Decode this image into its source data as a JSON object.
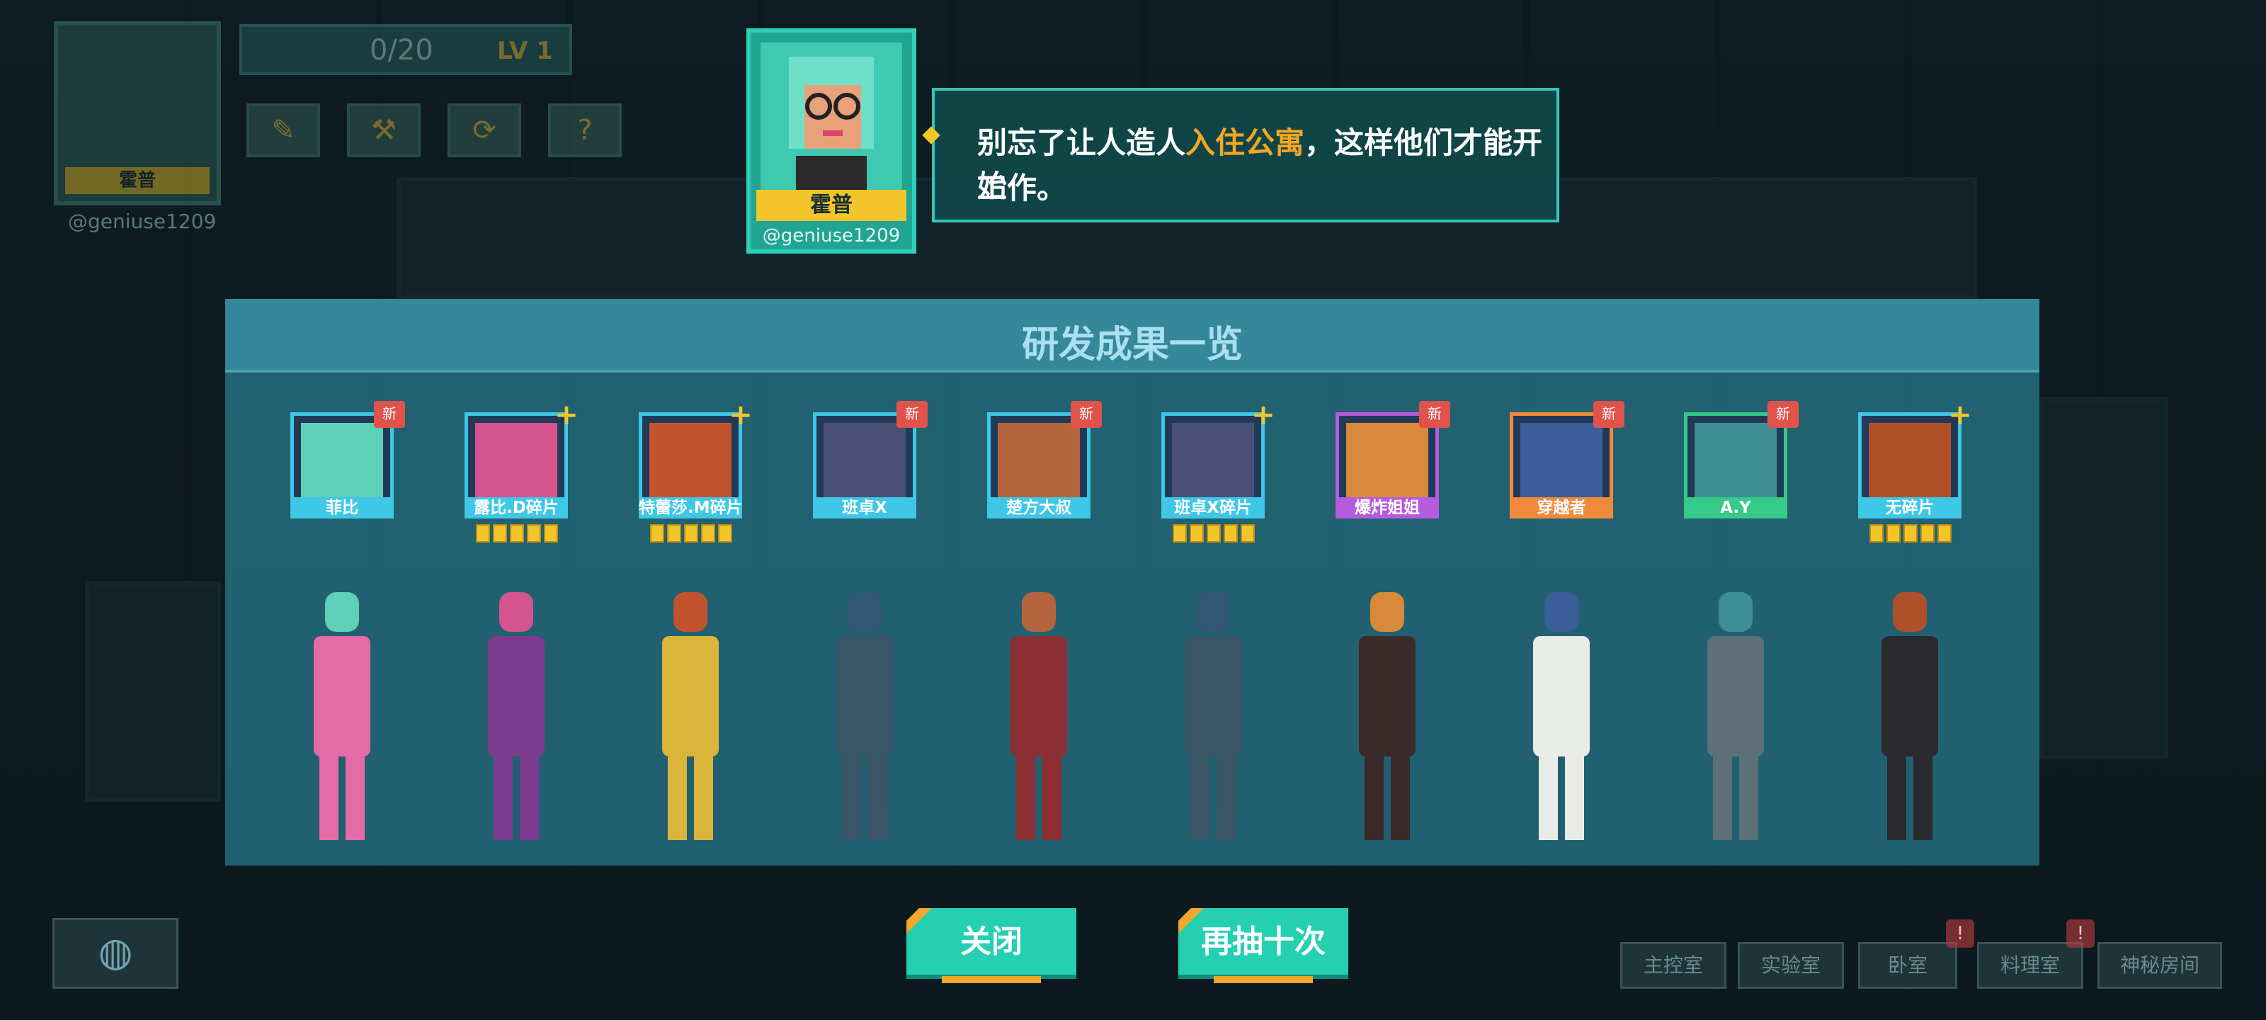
{
  "hud": {
    "player_name": "霍普",
    "handle": "@geniuse1209",
    "progress_text": "0/20",
    "level_text": "LV 1",
    "icons": [
      "note-icon",
      "wrench-icon",
      "refresh-icon",
      "question-icon"
    ]
  },
  "dialog": {
    "speaker_name": "霍普",
    "speaker_handle": "@geniuse1209",
    "text_before": "别忘了让人造人",
    "text_highlight": "入住公寓",
    "text_after": "，这样他们才能开始",
    "text_line2": "工作。"
  },
  "panel": {
    "title": "研发成果一览",
    "results": [
      {
        "label": "菲比",
        "badge": "新",
        "frame": "#3ec7e6",
        "art": "#5fd0b8",
        "figure": "#e46aa8",
        "fragments": 0
      },
      {
        "label": "露比.D碎片",
        "badge": "+",
        "frame": "#3ec7e6",
        "art": "#d3548e",
        "figure": "#7b3c8f",
        "fragments": 5
      },
      {
        "label": "特蕾莎.M碎片",
        "badge": "+",
        "frame": "#3ec7e6",
        "art": "#c3532e",
        "figure": "#d9b53a",
        "fragments": 5
      },
      {
        "label": "班卓X",
        "badge": "新",
        "frame": "#3ec7e6",
        "art": "#4a4f78",
        "figure": "#5b4b5e",
        "fragments": 0
      },
      {
        "label": "楚方大叔",
        "badge": "新",
        "frame": "#3ec7e6",
        "art": "#b5653e",
        "figure": "#8c2f33",
        "fragments": 0
      },
      {
        "label": "班卓X碎片",
        "badge": "+",
        "frame": "#3ec7e6",
        "art": "#4a4f78",
        "figure": "#5b4b5e",
        "fragments": 5
      },
      {
        "label": "爆炸姐姐",
        "badge": "新",
        "frame": "#b65be0",
        "art": "#d88a3a",
        "figure": "#3a2a2a",
        "fragments": 0
      },
      {
        "label": "穿越者",
        "badge": "新",
        "frame": "#f08a3a",
        "art": "#3a5f9a",
        "figure": "#e9ebe6",
        "fragments": 0
      },
      {
        "label": "A.Y",
        "badge": "新",
        "frame": "#35c98a",
        "art": "#3d8f95",
        "figure": "#5d6f78",
        "fragments": 0
      },
      {
        "label": "无碎片",
        "badge": "+",
        "frame": "#3ec7e6",
        "art": "#b0502a",
        "figure": "#2a2a2e",
        "fragments": 5
      }
    ]
  },
  "buttons": {
    "close_label": "关闭",
    "redraw_label": "再抽十次"
  },
  "nav": {
    "items": [
      "主控室",
      "实验室",
      "卧室",
      "料理室",
      "神秘房间"
    ],
    "alert": "!"
  },
  "colors": {
    "accent": "#25d0b2",
    "highlight": "#f5a623",
    "panel": "#2a7486"
  }
}
